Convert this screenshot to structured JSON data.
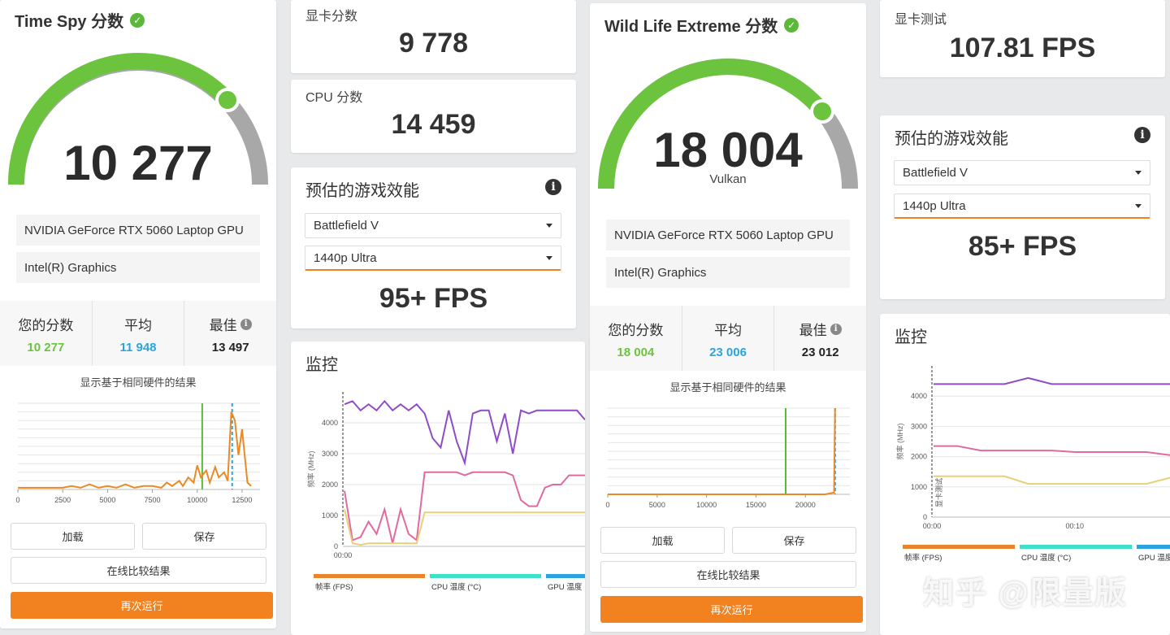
{
  "left": {
    "title": "Time Spy 分数",
    "score": "10 277",
    "gauge_fill": 0.78,
    "gauge_colors": {
      "fill": "#6cc33e",
      "track": "#a8a8a8"
    },
    "hardware": [
      "NVIDIA GeForce RTX 5060 Laptop GPU",
      "Intel(R) Graphics"
    ],
    "stats": [
      {
        "label": "您的分数",
        "value": "10 277",
        "color": "#6cc33e"
      },
      {
        "label": "平均",
        "value": "11 948",
        "color": "#2aa4df"
      },
      {
        "label": "最佳",
        "value": "13 497",
        "color": "#222222"
      }
    ],
    "note": "显示基于相同硬件的结果",
    "buttons": {
      "load": "加载",
      "save": "保存",
      "compare": "在线比较结果",
      "run": "再次运行"
    },
    "graphics_score_label": "显卡分数",
    "graphics_score": "9 778",
    "cpu_score_label": "CPU 分数",
    "cpu_score": "14 459",
    "game_perf": {
      "title": "预估的游戏效能",
      "game": "Battlefield V",
      "preset": "1440p Ultra",
      "fps": "95+ FPS"
    },
    "monitor": {
      "title": "监控",
      "ylabel": "频率 (MHz)",
      "x_tick": "00:00",
      "legend": [
        "帧率 (FPS)",
        "CPU 温度 (°C)",
        "GPU 温度"
      ]
    }
  },
  "right": {
    "title": "Wild Life Extreme 分数",
    "score": "18 004",
    "api": "Vulkan",
    "gauge_fill": 0.78,
    "hardware": [
      "NVIDIA GeForce RTX 5060 Laptop GPU",
      "Intel(R) Graphics"
    ],
    "stats": [
      {
        "label": "您的分数",
        "value": "18 004",
        "color": "#6cc33e"
      },
      {
        "label": "平均",
        "value": "23 006",
        "color": "#2aa4df"
      },
      {
        "label": "最佳",
        "value": "23 012",
        "color": "#222222"
      }
    ],
    "note": "显示基于相同硬件的结果",
    "buttons": {
      "load": "加载",
      "save": "保存",
      "compare": "在线比较结果",
      "run": "再次运行"
    },
    "gpu_test_label": "显卡测试",
    "gpu_test": "107.81 FPS",
    "game_perf": {
      "title": "预估的游戏效能",
      "game": "Battlefield V",
      "preset": "1440p Ultra",
      "fps": "85+ FPS"
    },
    "monitor": {
      "title": "监控",
      "ylabel": "频率 (MHz)",
      "x_ticks": [
        "00:00",
        "00:10"
      ],
      "vlabel": "显卡测试",
      "legend": [
        "帧率 (FPS)",
        "CPU 温度 (°C)",
        "GPU 温度"
      ]
    }
  },
  "watermark": "知乎 @限量版",
  "chart_data": [
    {
      "type": "line",
      "name": "distribution-timespy",
      "x_ticks": [
        0,
        2500,
        5000,
        7500,
        10000,
        12500
      ],
      "xlim": [
        0,
        13500
      ],
      "x": [
        0,
        1500,
        2500,
        3000,
        3500,
        4000,
        4500,
        5000,
        5500,
        6000,
        6500,
        7000,
        7500,
        8000,
        8300,
        8600,
        9000,
        9200,
        9500,
        9800,
        10000,
        10200,
        10500,
        10700,
        11000,
        11200,
        11500,
        11700,
        11900,
        12100,
        12300,
        12500,
        12800,
        13000
      ],
      "values": [
        2,
        2,
        2,
        4,
        2,
        6,
        2,
        4,
        2,
        6,
        2,
        4,
        4,
        2,
        8,
        4,
        10,
        4,
        14,
        8,
        28,
        14,
        22,
        8,
        26,
        14,
        20,
        10,
        90,
        80,
        40,
        70,
        8,
        4
      ],
      "ylim": [
        0,
        100
      ],
      "markers": {
        "your_score": 10277,
        "average": 11948
      }
    },
    {
      "type": "line",
      "name": "distribution-wildlife",
      "x_ticks": [
        0,
        5000,
        10000,
        15000,
        20000
      ],
      "xlim": [
        0,
        24500
      ],
      "x": [
        0,
        22000,
        22900,
        23000
      ],
      "values": [
        0,
        0,
        2,
        100
      ],
      "ylim": [
        0,
        100
      ],
      "markers": {
        "your_score": 18004,
        "average": 23006
      }
    },
    {
      "type": "line",
      "name": "monitor-timespy",
      "y_ticks": [
        0,
        1000,
        2000,
        3000,
        4000
      ],
      "ylim": [
        0,
        5000
      ],
      "x_ticks": [
        "00:00"
      ],
      "series": [
        {
          "values": [
            4600,
            4700,
            4400,
            4600,
            4400,
            4700,
            4400,
            4600,
            4400,
            4600,
            4300,
            3500,
            3200,
            4400,
            3400,
            2700,
            4300,
            4400,
            4400,
            3400,
            4300,
            3000,
            4400,
            4300,
            4400,
            4400,
            4400,
            4400,
            4400,
            4400,
            4100
          ],
          "color": "#8e4cc6"
        },
        {
          "values": [
            1800,
            200,
            300,
            800,
            400,
            1200,
            100,
            1200,
            400,
            200,
            2400,
            2400,
            2400,
            2400,
            2400,
            2300,
            2400,
            2400,
            2400,
            2400,
            2400,
            2300,
            1500,
            1300,
            1300,
            1900,
            2000,
            2000,
            2300,
            2300,
            2300
          ],
          "color": "#e06aa0"
        },
        {
          "values": [
            1200,
            100,
            50,
            100,
            100,
            100,
            100,
            100,
            100,
            100,
            1100,
            1100,
            1100,
            1100,
            1100,
            1100,
            1100,
            1100,
            1100,
            1100,
            1100,
            1100,
            1100,
            1100,
            1100,
            1100,
            1100,
            1100,
            1100,
            1100,
            1100
          ],
          "color": "#e8cf7a"
        }
      ]
    },
    {
      "type": "line",
      "name": "monitor-wildlife",
      "y_ticks": [
        0,
        1000,
        2000,
        3000,
        4000
      ],
      "ylim": [
        0,
        5000
      ],
      "x_ticks": [
        "00:00",
        "00:10"
      ],
      "series": [
        {
          "values": [
            4400,
            4400,
            4400,
            4400,
            4600,
            4400,
            4400,
            4400,
            4400,
            4400,
            4400
          ],
          "color": "#8e4cc6"
        },
        {
          "values": [
            2350,
            2350,
            2200,
            2200,
            2200,
            2200,
            2150,
            2150,
            2150,
            2150,
            2050
          ],
          "color": "#e06aa0"
        },
        {
          "values": [
            1350,
            1350,
            1350,
            1350,
            1100,
            1100,
            1100,
            1100,
            1100,
            1100,
            1300
          ],
          "color": "#e8cf7a"
        }
      ]
    }
  ]
}
